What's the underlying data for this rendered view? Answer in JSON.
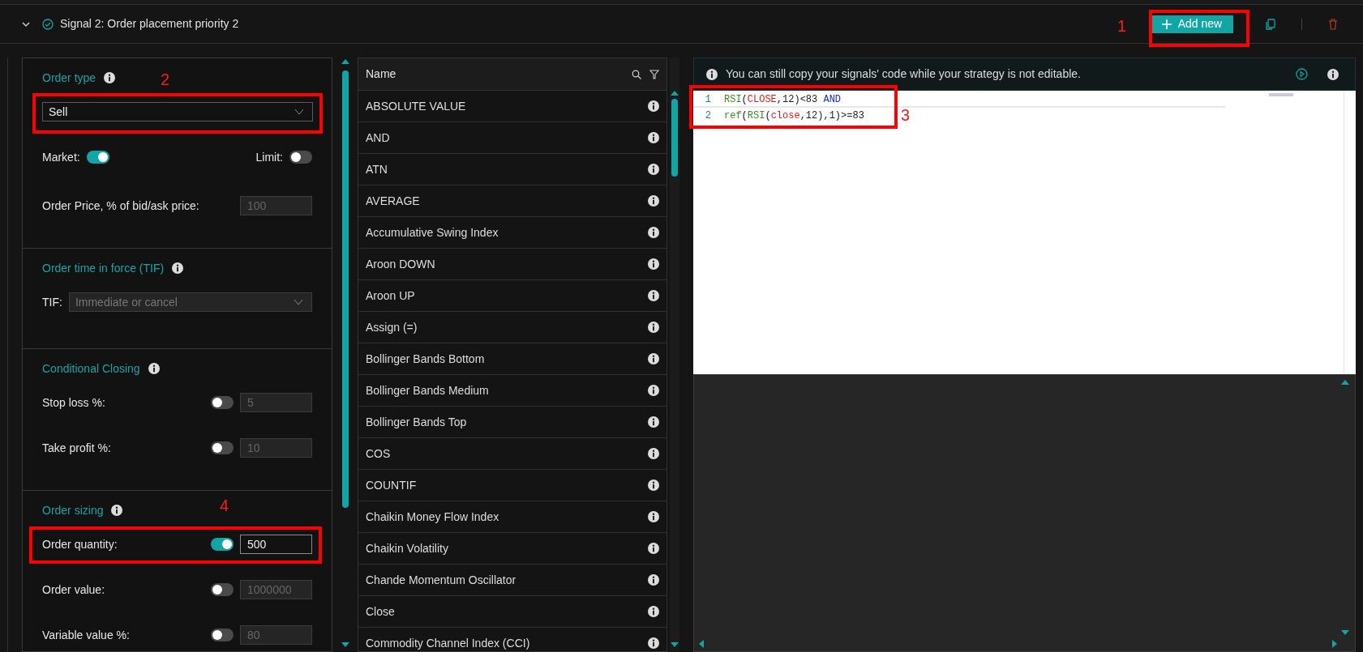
{
  "header": {
    "title": "Signal 2: Order placement priority 2",
    "expanded": true,
    "add_button": "Add new"
  },
  "order_panel": {
    "sections": [
      {
        "title": "Order type",
        "rows": [
          {
            "kind": "select",
            "value": "Sell",
            "disabled": false
          },
          {
            "kind": "toggle_pair",
            "items": [
              {
                "label": "Market:",
                "on": true
              },
              {
                "label": "Limit:",
                "on": false
              }
            ]
          },
          {
            "kind": "field",
            "label": "Order Price, % of bid/ask price:",
            "value": "100",
            "disabled": true
          }
        ]
      },
      {
        "title": "Order time in force (TIF)",
        "rows": [
          {
            "kind": "labeled_select",
            "label": "TIF:",
            "value": "Immediate or cancel",
            "disabled": true
          }
        ]
      },
      {
        "title": "Conditional Closing",
        "rows": [
          {
            "kind": "toggle_field",
            "label": "Stop loss %:",
            "on": false,
            "value": "5",
            "disabled": true
          },
          {
            "kind": "toggle_field",
            "label": "Take profit %:",
            "on": false,
            "value": "10",
            "disabled": true
          }
        ]
      },
      {
        "title": "Order sizing",
        "rows": [
          {
            "kind": "toggle_field",
            "label": "Order quantity:",
            "on": true,
            "value": "500",
            "disabled": false
          },
          {
            "kind": "toggle_field",
            "label": "Order value:",
            "on": false,
            "value": "1000000",
            "disabled": true
          },
          {
            "kind": "toggle_field",
            "label": "Variable value %:",
            "on": false,
            "value": "80",
            "disabled": true
          }
        ]
      }
    ]
  },
  "functions_table": {
    "column": "Name",
    "rows": [
      "ABSOLUTE VALUE",
      "AND",
      "ATN",
      "AVERAGE",
      "Accumulative Swing Index",
      "Aroon DOWN",
      "Aroon UP",
      "Assign (=)",
      "Bollinger Bands Bottom",
      "Bollinger Bands Medium",
      "Bollinger Bands Top",
      "COS",
      "COUNTIF",
      "Chaikin Money Flow Index",
      "Chaikin Volatility",
      "Chande Momentum Oscillator",
      "Close",
      "Commodity Channel Index (CCI)"
    ]
  },
  "editor": {
    "notice": "You can still copy your signals' code while your strategy is not editable.",
    "lines": [
      {
        "number": "1",
        "tokens": [
          {
            "kind": "function",
            "text": "RSI"
          },
          {
            "kind": "plain",
            "text": "("
          },
          {
            "kind": "variable",
            "text": "CLOSE"
          },
          {
            "kind": "plain",
            "text": ",12)<83 "
          },
          {
            "kind": "keyword",
            "text": "AND"
          }
        ]
      },
      {
        "number": "2",
        "tokens": [
          {
            "kind": "function",
            "text": "ref"
          },
          {
            "kind": "plain",
            "text": "("
          },
          {
            "kind": "function",
            "text": "RSI"
          },
          {
            "kind": "plain",
            "text": "("
          },
          {
            "kind": "variable",
            "text": "close"
          },
          {
            "kind": "plain",
            "text": ",12),1)>=83"
          }
        ]
      }
    ]
  },
  "annotations": [
    {
      "label": "1"
    },
    {
      "label": "2"
    },
    {
      "label": "3"
    },
    {
      "label": "4"
    }
  ]
}
